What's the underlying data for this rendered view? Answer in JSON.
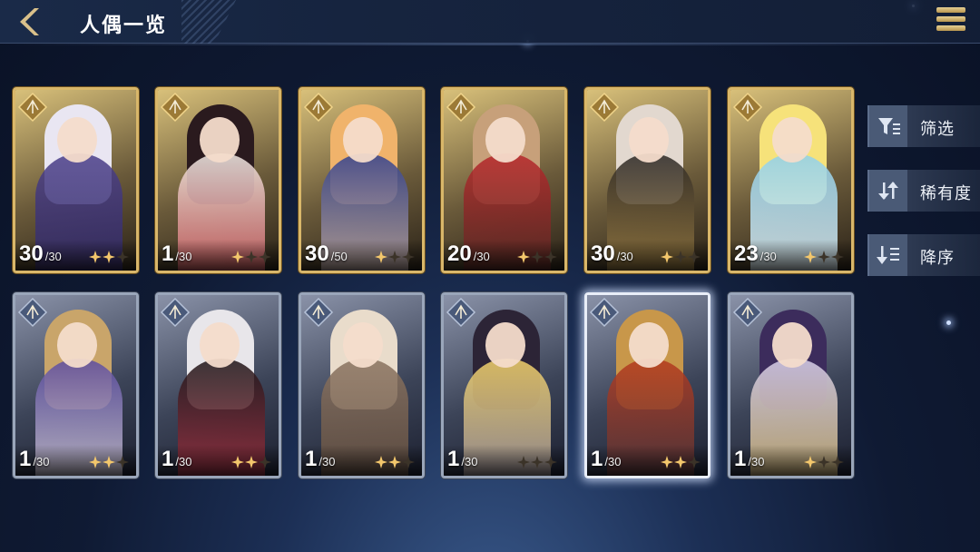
{
  "header": {
    "title": "人偶一览"
  },
  "controls": {
    "filter_label": "筛选",
    "rarity_label": "稀有度",
    "order_label": "降序"
  },
  "cards": [
    {
      "level": "30",
      "max": "/30",
      "stars": 2,
      "rarity": "gold",
      "class_icon": "crest-icon",
      "palette": [
        "#4b3f8a",
        "#e9e6f2",
        "#2a2459"
      ]
    },
    {
      "level": "1",
      "max": "/30",
      "stars": 1,
      "rarity": "gold",
      "class_icon": "crest-icon",
      "palette": [
        "#f1ebe6",
        "#2a1a1e",
        "#c8343a"
      ]
    },
    {
      "level": "30",
      "max": "/50",
      "stars": 1,
      "rarity": "gold",
      "class_icon": "crest-icon",
      "palette": [
        "#2f3f8f",
        "#f0b36b",
        "#eac9a8"
      ]
    },
    {
      "level": "20",
      "max": "/30",
      "stars": 1,
      "rarity": "gold",
      "class_icon": "crest-icon",
      "palette": [
        "#b8272b",
        "#c7a07a",
        "#3a2a22"
      ]
    },
    {
      "level": "30",
      "max": "/30",
      "stars": 1,
      "rarity": "gold",
      "class_icon": "crest-icon",
      "palette": [
        "#2a2624",
        "#e2d8cf",
        "#b8944a"
      ]
    },
    {
      "level": "23",
      "max": "/30",
      "stars": 1,
      "rarity": "gold",
      "class_icon": "crest-icon",
      "palette": [
        "#8fd0ec",
        "#f6e27a",
        "#f4f4f4"
      ]
    },
    {
      "level": "1",
      "max": "/30",
      "stars": 2,
      "rarity": "silver",
      "class_icon": "crest-icon",
      "palette": [
        "#5a4aa0",
        "#c9a56a",
        "#f0ece4"
      ]
    },
    {
      "level": "1",
      "max": "/30",
      "stars": 2,
      "rarity": "silver",
      "class_icon": "crest-icon",
      "palette": [
        "#1c1416",
        "#e8e6ea",
        "#c83a4e"
      ]
    },
    {
      "level": "1",
      "max": "/30",
      "stars": 2,
      "rarity": "silver",
      "class_icon": "crest-icon",
      "palette": [
        "#8a7360",
        "#e9dccb",
        "#5a4638"
      ]
    },
    {
      "level": "1",
      "max": "/30",
      "stars": 0,
      "rarity": "silver",
      "class_icon": "crest-icon",
      "palette": [
        "#f3d26a",
        "#2c2436",
        "#8c86a8"
      ]
    },
    {
      "level": "1",
      "max": "/30",
      "stars": 2,
      "rarity": "silver",
      "class_icon": "crest-icon",
      "palette": [
        "#b63a1e",
        "#c8974a",
        "#3a3440"
      ]
    },
    {
      "level": "1",
      "max": "/30",
      "stars": 1,
      "rarity": "silver",
      "class_icon": "crest-icon",
      "palette": [
        "#d8d0ec",
        "#3c2c5c",
        "#c8a850"
      ]
    }
  ]
}
